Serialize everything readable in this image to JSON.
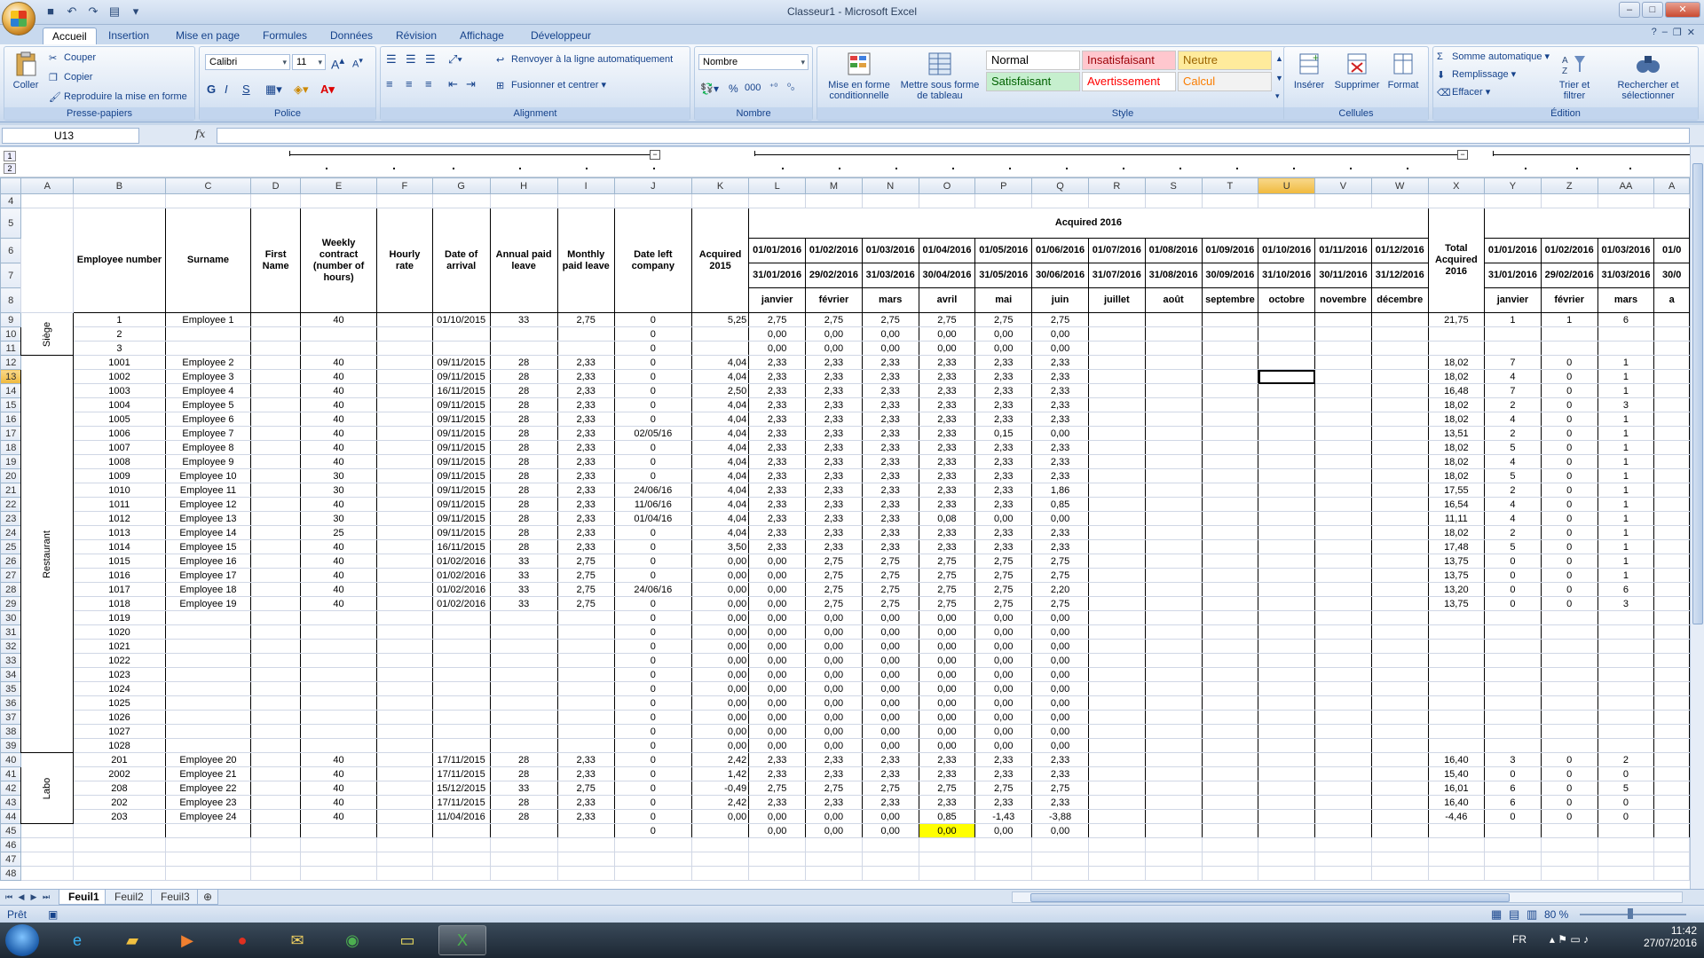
{
  "window": {
    "title": "Classeur1 - Microsoft Excel"
  },
  "ribbon_tabs": [
    "Accueil",
    "Insertion",
    "Mise en page",
    "Formules",
    "Données",
    "Révision",
    "Affichage",
    "Développeur"
  ],
  "clipboard": {
    "paste": "Coller",
    "cut": "Couper",
    "copy": "Copier",
    "format_painter": "Reproduire la mise en forme",
    "label": "Presse-papiers"
  },
  "font": {
    "name": "Calibri",
    "size": "11",
    "bold": "G",
    "italic": "I",
    "underline": "S",
    "label": "Police"
  },
  "alignment": {
    "wrap": "Renvoyer à la ligne automatiquement",
    "merge": "Fusionner et centrer",
    "label": "Alignment"
  },
  "number": {
    "format": "Nombre",
    "label": "Nombre"
  },
  "style": {
    "cond_format": "Mise en forme conditionnelle",
    "table_format": "Mettre sous forme de tableau",
    "label": "Style",
    "cells": [
      {
        "text": "Normal",
        "bg": "#ffffff",
        "fg": "#000000"
      },
      {
        "text": "Insatisfaisant",
        "bg": "#ffc7ce",
        "fg": "#9c0006"
      },
      {
        "text": "Neutre",
        "bg": "#ffeb9c",
        "fg": "#9c6500"
      },
      {
        "text": "Satisfaisant",
        "bg": "#c6efce",
        "fg": "#006100"
      },
      {
        "text": "Avertissement",
        "bg": "#ffffff",
        "fg": "#ff0000"
      },
      {
        "text": "Calcul",
        "bg": "#f2f2f2",
        "fg": "#fa7d00"
      }
    ]
  },
  "cells_group": {
    "insert": "Insérer",
    "delete": "Supprimer",
    "format": "Format",
    "label": "Cellules"
  },
  "editing": {
    "autosum": "Somme automatique",
    "fill": "Remplissage",
    "clear": "Effacer",
    "sort": "Trier et filtrer",
    "find": "Rechercher et sélectionner",
    "label": "Édition"
  },
  "formula_bar": {
    "name_box": "U13",
    "fx": "fx",
    "content": ""
  },
  "outline": {
    "level1": "1",
    "level2": "2",
    "collapse": "−"
  },
  "columns": [
    "A",
    "B",
    "C",
    "D",
    "E",
    "F",
    "G",
    "H",
    "I",
    "J",
    "K",
    "L",
    "M",
    "N",
    "O",
    "P",
    "Q",
    "R",
    "S",
    "T",
    "U",
    "V",
    "W",
    "X",
    "Y",
    "Z",
    "AA",
    "A"
  ],
  "header": {
    "employee_number": "Employee number",
    "surname": "Surname",
    "first_name": "First Name",
    "weekly": "Weekly contract (number of hours)",
    "hourly": "Hourly rate",
    "arrival": "Date of arrival",
    "annual": "Annual paid leave",
    "monthly": "Monthly paid leave",
    "left": "Date left company",
    "acq2015": "Acquired 2015",
    "acq2016": "Acquired 2016",
    "total2016": "Total Acquired 2016",
    "starts": [
      "01/01/2016",
      "01/02/2016",
      "01/03/2016",
      "01/04/2016",
      "01/05/2016",
      "01/06/2016",
      "01/07/2016",
      "01/08/2016",
      "01/09/2016",
      "01/10/2016",
      "01/11/2016",
      "01/12/2016"
    ],
    "ends": [
      "31/01/2016",
      "29/02/2016",
      "31/03/2016",
      "30/04/2016",
      "31/05/2016",
      "30/06/2016",
      "31/07/2016",
      "31/08/2016",
      "30/09/2016",
      "31/10/2016",
      "30/11/2016",
      "31/12/2016"
    ],
    "months": [
      "janvier",
      "février",
      "mars",
      "avril",
      "mai",
      "juin",
      "juillet",
      "août",
      "septembre",
      "octobre",
      "novembre",
      "décembre"
    ],
    "starts2": [
      "01/01/2016",
      "01/02/2016",
      "01/03/2016",
      "01/0"
    ],
    "ends2": [
      "31/01/2016",
      "29/02/2016",
      "31/03/2016",
      "30/0"
    ],
    "months2": [
      "janvier",
      "février",
      "mars",
      "a"
    ]
  },
  "groups": {
    "siege": "Siège",
    "restaurant": "Restaurant",
    "labo": "Labo"
  },
  "rows": [
    {
      "r": "9",
      "num": "1",
      "name": "Employee 1",
      "wk": "40",
      "arr": "01/10/2015",
      "ann": "33",
      "mon": "2,75",
      "left": "0",
      "a15": "5,25",
      "m": [
        "2,75",
        "2,75",
        "2,75",
        "2,75",
        "2,75",
        "2,75"
      ],
      "tot": "21,75",
      "x": [
        "1",
        "1",
        "6"
      ]
    },
    {
      "r": "10",
      "num": "2",
      "name": "",
      "wk": "",
      "arr": "",
      "ann": "",
      "mon": "",
      "left": "0",
      "a15": "",
      "m": [
        "0,00",
        "0,00",
        "0,00",
        "0,00",
        "0,00",
        "0,00"
      ],
      "tot": "",
      "x": [
        "",
        "",
        ""
      ]
    },
    {
      "r": "11",
      "num": "3",
      "name": "",
      "wk": "",
      "arr": "",
      "ann": "",
      "mon": "",
      "left": "0",
      "a15": "",
      "m": [
        "0,00",
        "0,00",
        "0,00",
        "0,00",
        "0,00",
        "0,00"
      ],
      "tot": "",
      "x": [
        "",
        "",
        ""
      ]
    },
    {
      "r": "12",
      "num": "1001",
      "name": "Employee 2",
      "wk": "40",
      "arr": "09/11/2015",
      "ann": "28",
      "mon": "2,33",
      "left": "0",
      "a15": "4,04",
      "m": [
        "2,33",
        "2,33",
        "2,33",
        "2,33",
        "2,33",
        "2,33"
      ],
      "tot": "18,02",
      "x": [
        "7",
        "0",
        "1"
      ]
    },
    {
      "r": "13",
      "num": "1002",
      "name": "Employee 3",
      "wk": "40",
      "arr": "09/11/2015",
      "ann": "28",
      "mon": "2,33",
      "left": "0",
      "a15": "4,04",
      "m": [
        "2,33",
        "2,33",
        "2,33",
        "2,33",
        "2,33",
        "2,33"
      ],
      "tot": "18,02",
      "x": [
        "4",
        "0",
        "1"
      ]
    },
    {
      "r": "14",
      "num": "1003",
      "name": "Employee 4",
      "wk": "40",
      "arr": "16/11/2015",
      "ann": "28",
      "mon": "2,33",
      "left": "0",
      "a15": "2,50",
      "m": [
        "2,33",
        "2,33",
        "2,33",
        "2,33",
        "2,33",
        "2,33"
      ],
      "tot": "16,48",
      "x": [
        "7",
        "0",
        "1"
      ]
    },
    {
      "r": "15",
      "num": "1004",
      "name": "Employee 5",
      "wk": "40",
      "arr": "09/11/2015",
      "ann": "28",
      "mon": "2,33",
      "left": "0",
      "a15": "4,04",
      "m": [
        "2,33",
        "2,33",
        "2,33",
        "2,33",
        "2,33",
        "2,33"
      ],
      "tot": "18,02",
      "x": [
        "2",
        "0",
        "3"
      ]
    },
    {
      "r": "16",
      "num": "1005",
      "name": "Employee 6",
      "wk": "40",
      "arr": "09/11/2015",
      "ann": "28",
      "mon": "2,33",
      "left": "0",
      "a15": "4,04",
      "m": [
        "2,33",
        "2,33",
        "2,33",
        "2,33",
        "2,33",
        "2,33"
      ],
      "tot": "18,02",
      "x": [
        "4",
        "0",
        "1"
      ]
    },
    {
      "r": "17",
      "num": "1006",
      "name": "Employee 7",
      "wk": "40",
      "arr": "09/11/2015",
      "ann": "28",
      "mon": "2,33",
      "left": "02/05/16",
      "a15": "4,04",
      "m": [
        "2,33",
        "2,33",
        "2,33",
        "2,33",
        "0,15",
        "0,00"
      ],
      "tot": "13,51",
      "x": [
        "2",
        "0",
        "1"
      ]
    },
    {
      "r": "18",
      "num": "1007",
      "name": "Employee 8",
      "wk": "40",
      "arr": "09/11/2015",
      "ann": "28",
      "mon": "2,33",
      "left": "0",
      "a15": "4,04",
      "m": [
        "2,33",
        "2,33",
        "2,33",
        "2,33",
        "2,33",
        "2,33"
      ],
      "tot": "18,02",
      "x": [
        "5",
        "0",
        "1"
      ]
    },
    {
      "r": "19",
      "num": "1008",
      "name": "Employee 9",
      "wk": "40",
      "arr": "09/11/2015",
      "ann": "28",
      "mon": "2,33",
      "left": "0",
      "a15": "4,04",
      "m": [
        "2,33",
        "2,33",
        "2,33",
        "2,33",
        "2,33",
        "2,33"
      ],
      "tot": "18,02",
      "x": [
        "4",
        "0",
        "1"
      ]
    },
    {
      "r": "20",
      "num": "1009",
      "name": "Employee 10",
      "wk": "30",
      "arr": "09/11/2015",
      "ann": "28",
      "mon": "2,33",
      "left": "0",
      "a15": "4,04",
      "m": [
        "2,33",
        "2,33",
        "2,33",
        "2,33",
        "2,33",
        "2,33"
      ],
      "tot": "18,02",
      "x": [
        "5",
        "0",
        "1"
      ]
    },
    {
      "r": "21",
      "num": "1010",
      "name": "Employee 11",
      "wk": "30",
      "arr": "09/11/2015",
      "ann": "28",
      "mon": "2,33",
      "left": "24/06/16",
      "a15": "4,04",
      "m": [
        "2,33",
        "2,33",
        "2,33",
        "2,33",
        "2,33",
        "1,86"
      ],
      "tot": "17,55",
      "x": [
        "2",
        "0",
        "1"
      ]
    },
    {
      "r": "22",
      "num": "1011",
      "name": "Employee 12",
      "wk": "40",
      "arr": "09/11/2015",
      "ann": "28",
      "mon": "2,33",
      "left": "11/06/16",
      "a15": "4,04",
      "m": [
        "2,33",
        "2,33",
        "2,33",
        "2,33",
        "2,33",
        "0,85"
      ],
      "tot": "16,54",
      "x": [
        "4",
        "0",
        "1"
      ]
    },
    {
      "r": "23",
      "num": "1012",
      "name": "Employee 13",
      "wk": "30",
      "arr": "09/11/2015",
      "ann": "28",
      "mon": "2,33",
      "left": "01/04/16",
      "a15": "4,04",
      "m": [
        "2,33",
        "2,33",
        "2,33",
        "0,08",
        "0,00",
        "0,00"
      ],
      "tot": "11,11",
      "x": [
        "4",
        "0",
        "1"
      ]
    },
    {
      "r": "24",
      "num": "1013",
      "name": "Employee 14",
      "wk": "25",
      "arr": "09/11/2015",
      "ann": "28",
      "mon": "2,33",
      "left": "0",
      "a15": "4,04",
      "m": [
        "2,33",
        "2,33",
        "2,33",
        "2,33",
        "2,33",
        "2,33"
      ],
      "tot": "18,02",
      "x": [
        "2",
        "0",
        "1"
      ]
    },
    {
      "r": "25",
      "num": "1014",
      "name": "Employee 15",
      "wk": "40",
      "arr": "16/11/2015",
      "ann": "28",
      "mon": "2,33",
      "left": "0",
      "a15": "3,50",
      "m": [
        "2,33",
        "2,33",
        "2,33",
        "2,33",
        "2,33",
        "2,33"
      ],
      "tot": "17,48",
      "x": [
        "5",
        "0",
        "1"
      ]
    },
    {
      "r": "26",
      "num": "1015",
      "name": "Employee 16",
      "wk": "40",
      "arr": "01/02/2016",
      "ann": "33",
      "mon": "2,75",
      "left": "0",
      "a15": "0,00",
      "m": [
        "0,00",
        "2,75",
        "2,75",
        "2,75",
        "2,75",
        "2,75"
      ],
      "tot": "13,75",
      "x": [
        "0",
        "0",
        "1"
      ]
    },
    {
      "r": "27",
      "num": "1016",
      "name": "Employee 17",
      "wk": "40",
      "arr": "01/02/2016",
      "ann": "33",
      "mon": "2,75",
      "left": "0",
      "a15": "0,00",
      "m": [
        "0,00",
        "2,75",
        "2,75",
        "2,75",
        "2,75",
        "2,75"
      ],
      "tot": "13,75",
      "x": [
        "0",
        "0",
        "1"
      ]
    },
    {
      "r": "28",
      "num": "1017",
      "name": "Employee 18",
      "wk": "40",
      "arr": "01/02/2016",
      "ann": "33",
      "mon": "2,75",
      "left": "24/06/16",
      "a15": "0,00",
      "m": [
        "0,00",
        "2,75",
        "2,75",
        "2,75",
        "2,75",
        "2,20"
      ],
      "tot": "13,20",
      "x": [
        "0",
        "0",
        "6"
      ]
    },
    {
      "r": "29",
      "num": "1018",
      "name": "Employee 19",
      "wk": "40",
      "arr": "01/02/2016",
      "ann": "33",
      "mon": "2,75",
      "left": "0",
      "a15": "0,00",
      "m": [
        "0,00",
        "2,75",
        "2,75",
        "2,75",
        "2,75",
        "2,75"
      ],
      "tot": "13,75",
      "x": [
        "0",
        "0",
        "3"
      ]
    },
    {
      "r": "30",
      "num": "1019",
      "name": "",
      "wk": "",
      "arr": "",
      "ann": "",
      "mon": "",
      "left": "0",
      "a15": "0,00",
      "m": [
        "0,00",
        "0,00",
        "0,00",
        "0,00",
        "0,00",
        "0,00"
      ],
      "tot": "",
      "x": [
        "",
        "",
        ""
      ]
    },
    {
      "r": "31",
      "num": "1020",
      "name": "",
      "wk": "",
      "arr": "",
      "ann": "",
      "mon": "",
      "left": "0",
      "a15": "0,00",
      "m": [
        "0,00",
        "0,00",
        "0,00",
        "0,00",
        "0,00",
        "0,00"
      ],
      "tot": "",
      "x": [
        "",
        "",
        ""
      ]
    },
    {
      "r": "32",
      "num": "1021",
      "name": "",
      "wk": "",
      "arr": "",
      "ann": "",
      "mon": "",
      "left": "0",
      "a15": "0,00",
      "m": [
        "0,00",
        "0,00",
        "0,00",
        "0,00",
        "0,00",
        "0,00"
      ],
      "tot": "",
      "x": [
        "",
        "",
        ""
      ]
    },
    {
      "r": "33",
      "num": "1022",
      "name": "",
      "wk": "",
      "arr": "",
      "ann": "",
      "mon": "",
      "left": "0",
      "a15": "0,00",
      "m": [
        "0,00",
        "0,00",
        "0,00",
        "0,00",
        "0,00",
        "0,00"
      ],
      "tot": "",
      "x": [
        "",
        "",
        ""
      ]
    },
    {
      "r": "34",
      "num": "1023",
      "name": "",
      "wk": "",
      "arr": "",
      "ann": "",
      "mon": "",
      "left": "0",
      "a15": "0,00",
      "m": [
        "0,00",
        "0,00",
        "0,00",
        "0,00",
        "0,00",
        "0,00"
      ],
      "tot": "",
      "x": [
        "",
        "",
        ""
      ]
    },
    {
      "r": "35",
      "num": "1024",
      "name": "",
      "wk": "",
      "arr": "",
      "ann": "",
      "mon": "",
      "left": "0",
      "a15": "0,00",
      "m": [
        "0,00",
        "0,00",
        "0,00",
        "0,00",
        "0,00",
        "0,00"
      ],
      "tot": "",
      "x": [
        "",
        "",
        ""
      ]
    },
    {
      "r": "36",
      "num": "1025",
      "name": "",
      "wk": "",
      "arr": "",
      "ann": "",
      "mon": "",
      "left": "0",
      "a15": "0,00",
      "m": [
        "0,00",
        "0,00",
        "0,00",
        "0,00",
        "0,00",
        "0,00"
      ],
      "tot": "",
      "x": [
        "",
        "",
        ""
      ]
    },
    {
      "r": "37",
      "num": "1026",
      "name": "",
      "wk": "",
      "arr": "",
      "ann": "",
      "mon": "",
      "left": "0",
      "a15": "0,00",
      "m": [
        "0,00",
        "0,00",
        "0,00",
        "0,00",
        "0,00",
        "0,00"
      ],
      "tot": "",
      "x": [
        "",
        "",
        ""
      ]
    },
    {
      "r": "38",
      "num": "1027",
      "name": "",
      "wk": "",
      "arr": "",
      "ann": "",
      "mon": "",
      "left": "0",
      "a15": "0,00",
      "m": [
        "0,00",
        "0,00",
        "0,00",
        "0,00",
        "0,00",
        "0,00"
      ],
      "tot": "",
      "x": [
        "",
        "",
        ""
      ]
    },
    {
      "r": "39",
      "num": "1028",
      "name": "",
      "wk": "",
      "arr": "",
      "ann": "",
      "mon": "",
      "left": "0",
      "a15": "0,00",
      "m": [
        "0,00",
        "0,00",
        "0,00",
        "0,00",
        "0,00",
        "0,00"
      ],
      "tot": "",
      "x": [
        "",
        "",
        ""
      ]
    },
    {
      "r": "40",
      "num": "201",
      "name": "Employee 20",
      "wk": "40",
      "arr": "17/11/2015",
      "ann": "28",
      "mon": "2,33",
      "left": "0",
      "a15": "2,42",
      "m": [
        "2,33",
        "2,33",
        "2,33",
        "2,33",
        "2,33",
        "2,33"
      ],
      "tot": "16,40",
      "x": [
        "3",
        "0",
        "2"
      ]
    },
    {
      "r": "41",
      "num": "2002",
      "name": "Employee 21",
      "wk": "40",
      "arr": "17/11/2015",
      "ann": "28",
      "mon": "2,33",
      "left": "0",
      "a15": "1,42",
      "m": [
        "2,33",
        "2,33",
        "2,33",
        "2,33",
        "2,33",
        "2,33"
      ],
      "tot": "15,40",
      "x": [
        "0",
        "0",
        "0"
      ]
    },
    {
      "r": "42",
      "num": "208",
      "name": "Employee 22",
      "wk": "40",
      "arr": "15/12/2015",
      "ann": "33",
      "mon": "2,75",
      "left": "0",
      "a15": "-0,49",
      "m": [
        "2,75",
        "2,75",
        "2,75",
        "2,75",
        "2,75",
        "2,75"
      ],
      "tot": "16,01",
      "x": [
        "6",
        "0",
        "5"
      ]
    },
    {
      "r": "43",
      "num": "202",
      "name": "Employee 23",
      "wk": "40",
      "arr": "17/11/2015",
      "ann": "28",
      "mon": "2,33",
      "left": "0",
      "a15": "2,42",
      "m": [
        "2,33",
        "2,33",
        "2,33",
        "2,33",
        "2,33",
        "2,33"
      ],
      "tot": "16,40",
      "x": [
        "6",
        "0",
        "0"
      ]
    },
    {
      "r": "44",
      "num": "203",
      "name": "Employee 24",
      "wk": "40",
      "arr": "11/04/2016",
      "ann": "28",
      "mon": "2,33",
      "left": "0",
      "a15": "0,00",
      "m": [
        "0,00",
        "0,00",
        "0,00",
        "0,85",
        "-1,43",
        "-3,88"
      ],
      "tot": "-4,46",
      "x": [
        "0",
        "0",
        "0"
      ]
    },
    {
      "r": "45",
      "num": "",
      "name": "",
      "wk": "",
      "arr": "",
      "ann": "",
      "mon": "",
      "left": "0",
      "a15": "",
      "m": [
        "0,00",
        "0,00",
        "0,00",
        "0,00",
        "0,00",
        "0,00"
      ],
      "tot": "",
      "x": [
        "",
        "",
        ""
      ]
    }
  ],
  "trailing_rows": [
    "46",
    "47",
    "48"
  ],
  "sheets": [
    "Feuil1",
    "Feuil2",
    "Feuil3"
  ],
  "status": {
    "ready": "Prêt",
    "zoom": "80 %"
  },
  "taskbar": {
    "lang": "FR",
    "time": "11:42",
    "date": "27/07/2016"
  }
}
